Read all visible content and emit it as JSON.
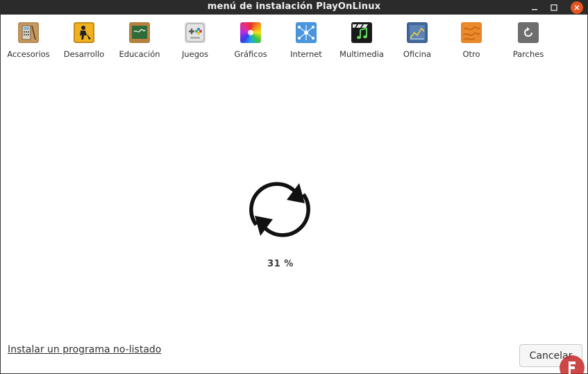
{
  "window": {
    "title": "menú de instalación PlayOnLinux"
  },
  "categories": [
    {
      "label": "Accesorios",
      "icon": "accessories-icon"
    },
    {
      "label": "Desarrollo",
      "icon": "development-icon"
    },
    {
      "label": "Educación",
      "icon": "education-icon"
    },
    {
      "label": "Juegos",
      "icon": "games-icon"
    },
    {
      "label": "Gráficos",
      "icon": "graphics-icon"
    },
    {
      "label": "Internet",
      "icon": "internet-icon"
    },
    {
      "label": "Multimedia",
      "icon": "multimedia-icon"
    },
    {
      "label": "Oficina",
      "icon": "office-icon"
    },
    {
      "label": "Otro",
      "icon": "other-icon"
    },
    {
      "label": "Parches",
      "icon": "patches-icon"
    }
  ],
  "progress": {
    "percent_label": "31 %",
    "value": 31
  },
  "footer": {
    "unlisted_link": "Instalar un programa no-listado",
    "cancel_label": "Cancelar"
  },
  "colors": {
    "titlebar": "#2b2b2b",
    "close_button": "#e95420"
  }
}
